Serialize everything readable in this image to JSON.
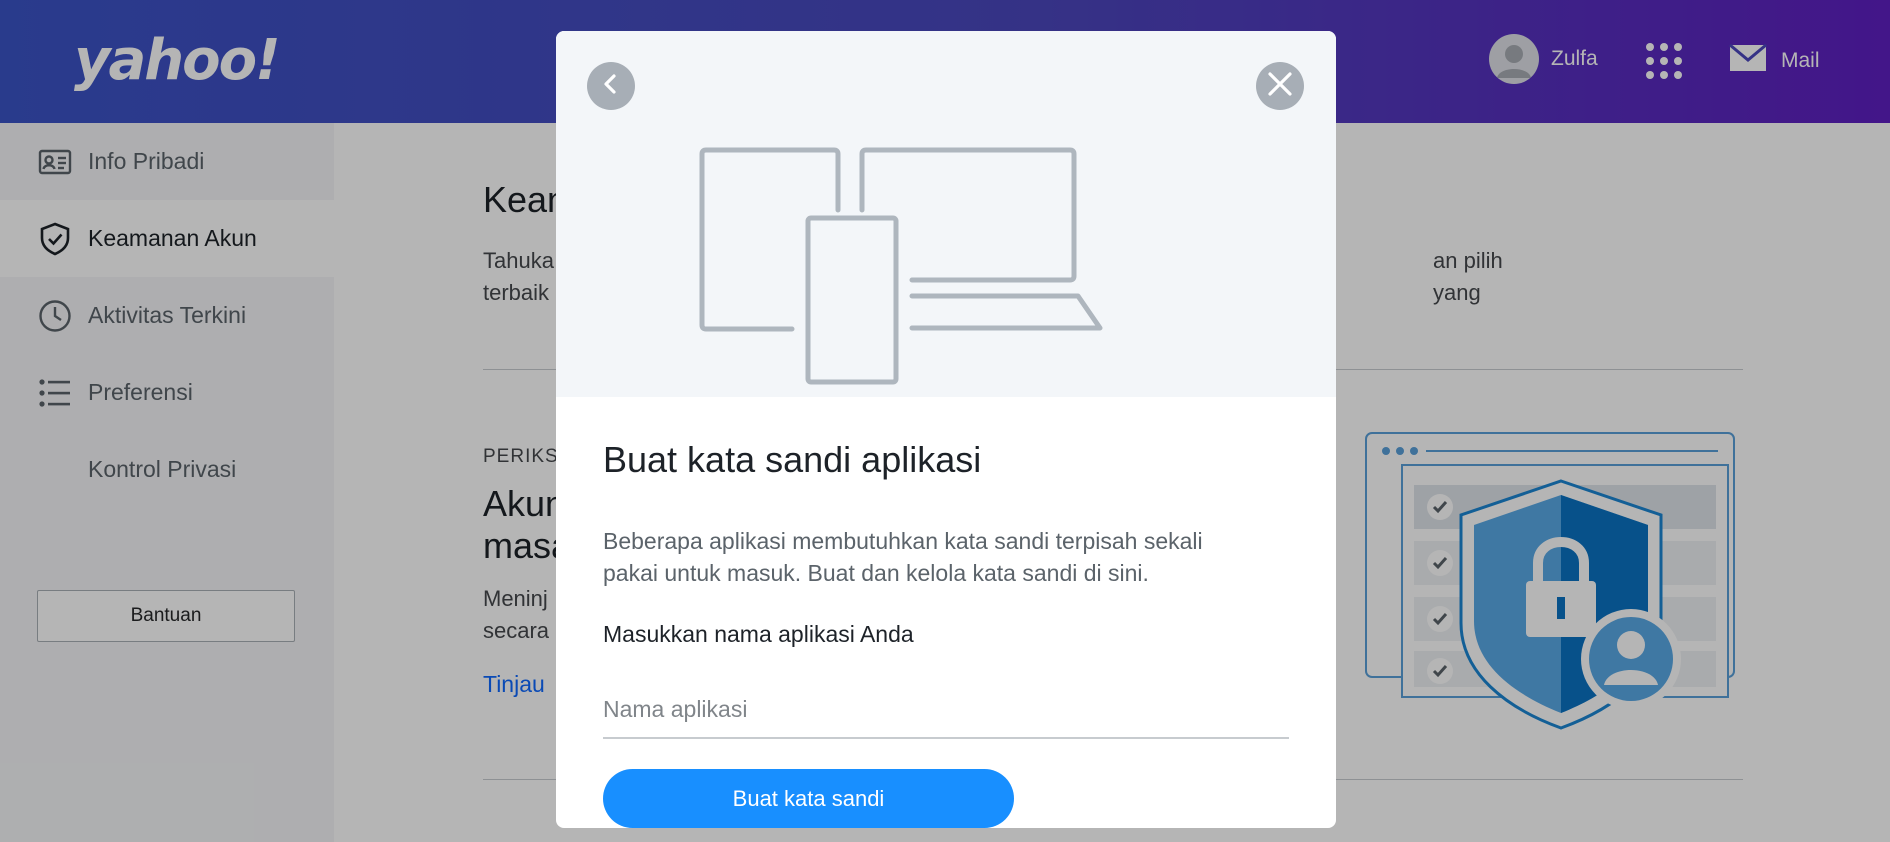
{
  "header": {
    "logo_text": "yahoo!",
    "user_name": "Zulfa",
    "mail_label": "Mail",
    "colors": {
      "gradient_start": "#3b53c6",
      "gradient_end": "#5f1fc1"
    }
  },
  "sidebar": {
    "items": [
      {
        "label": "Info Pribadi",
        "icon": "id-card-icon"
      },
      {
        "label": "Keamanan Akun",
        "icon": "shield-check-icon",
        "active": true
      },
      {
        "label": "Aktivitas Terkini",
        "icon": "clock-icon"
      },
      {
        "label": "Preferensi",
        "icon": "list-icon"
      },
      {
        "label": "Kontrol Privasi",
        "icon": ""
      }
    ],
    "help_label": "Bantuan"
  },
  "main": {
    "title": "Kean",
    "desc_line1": "Tahuka",
    "desc_line1_right": "an pilih yang",
    "desc_line2": "terbaik",
    "kicker": "PERIKS",
    "subtitle_line1": "Akun",
    "subtitle_line2": "masa",
    "body_line1": "Meninj",
    "body_line2": "secara",
    "link": "Tinjau"
  },
  "modal": {
    "title": "Buat kata sandi aplikasi",
    "description": "Beberapa aplikasi membutuhkan kata sandi terpisah sekali pakai untuk masuk. Buat dan kelola kata sandi di sini.",
    "field_label": "Masukkan nama aplikasi Anda",
    "input_placeholder": "Nama aplikasi",
    "input_value": "",
    "submit_label": "Buat kata sandi",
    "back_icon": "chevron-left-icon",
    "close_icon": "close-icon",
    "accent_color": "#188fff"
  }
}
